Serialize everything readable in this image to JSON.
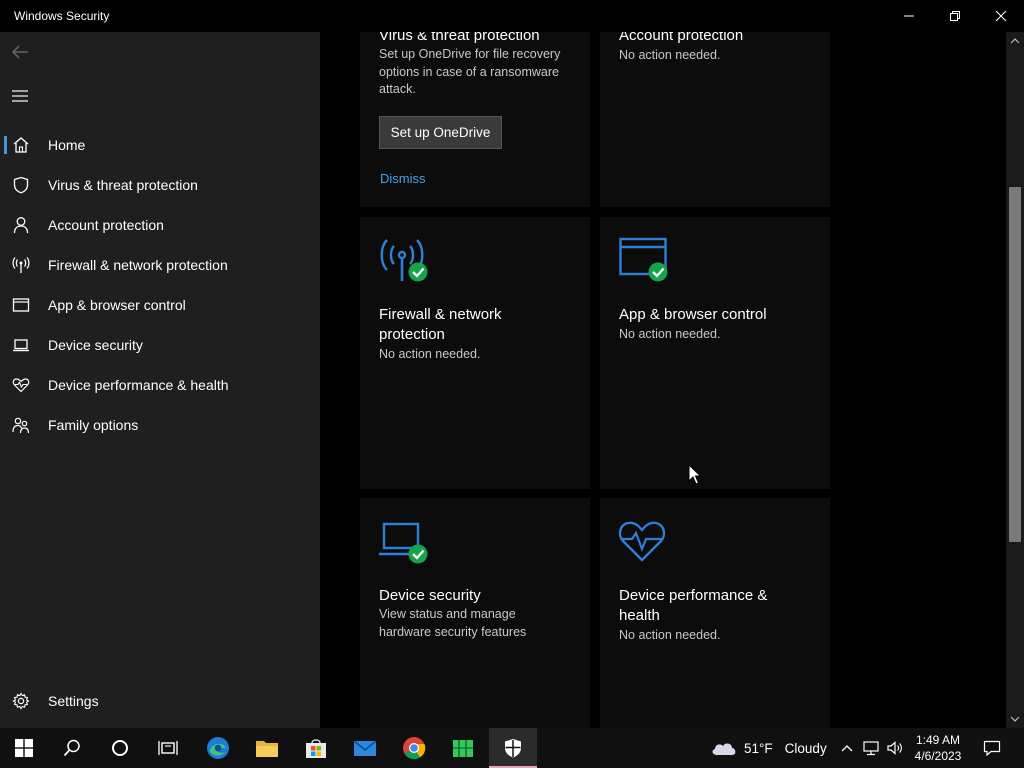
{
  "window": {
    "title": "Windows Security"
  },
  "sidebar": {
    "items": [
      {
        "label": "Home",
        "icon": "home-icon"
      },
      {
        "label": "Virus & threat protection",
        "icon": "shield-icon"
      },
      {
        "label": "Account protection",
        "icon": "person-icon"
      },
      {
        "label": "Firewall & network protection",
        "icon": "antenna-icon"
      },
      {
        "label": "App & browser control",
        "icon": "browser-window-icon"
      },
      {
        "label": "Device security",
        "icon": "laptop-icon"
      },
      {
        "label": "Device performance & health",
        "icon": "heart-pulse-icon"
      },
      {
        "label": "Family options",
        "icon": "family-icon"
      }
    ],
    "settings_label": "Settings"
  },
  "cards": {
    "virus": {
      "title": "Virus & threat protection",
      "desc_line1": "Set up OneDrive for file recovery",
      "desc_line2": "options in case of a ransomware",
      "desc_line3": "attack.",
      "button": "Set up OneDrive",
      "link": "Dismiss"
    },
    "account": {
      "title": "Account protection",
      "status": "No action needed."
    },
    "firewall": {
      "title_line1": "Firewall & network",
      "title_line2": "protection",
      "status": "No action needed."
    },
    "app_browser": {
      "title": "App & browser control",
      "status": "No action needed."
    },
    "device_security": {
      "title": "Device security",
      "desc_line1": "View status and manage",
      "desc_line2": "hardware security features"
    },
    "device_performance": {
      "title_line1": "Device performance &",
      "title_line2": "health",
      "status": "No action needed."
    }
  },
  "taskbar": {
    "weather_temp": "51°F",
    "weather_text": "Cloudy",
    "time": "1:49 AM",
    "date": "4/6/2023"
  },
  "colors": {
    "accent": "#3a96dd",
    "icon_blue": "#2f7fd6",
    "check_green": "#16a34a",
    "sidebar_bg": "#1f1f1f",
    "link": "#4aa0e8"
  }
}
